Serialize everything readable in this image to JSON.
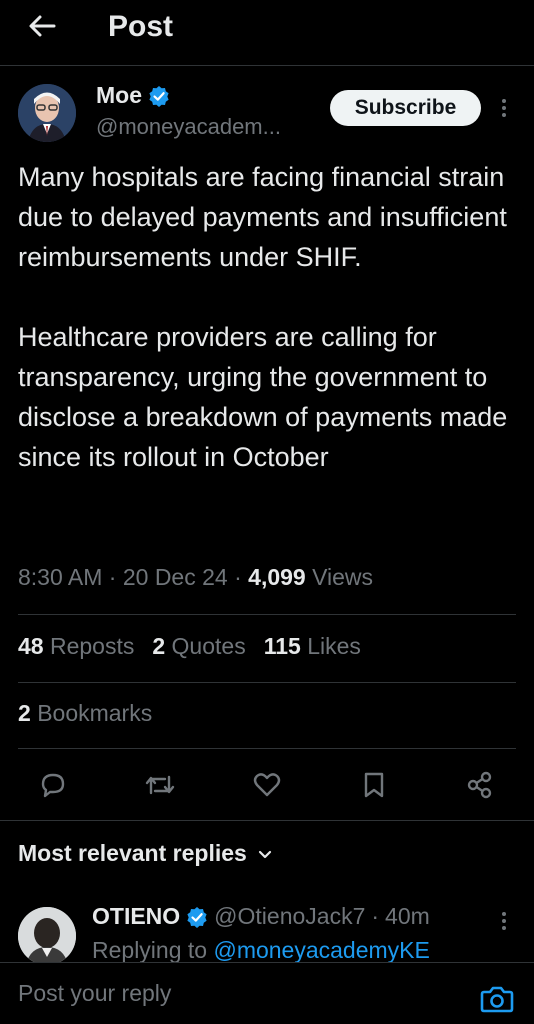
{
  "header": {
    "title": "Post",
    "back_icon": "arrow-left-icon"
  },
  "post": {
    "author": {
      "name": "Moe",
      "handle": "@moneyacadem...",
      "verified": true,
      "subscribe_label": "Subscribe"
    },
    "paragraphs": [
      "Many hospitals are facing financial strain due to delayed payments and insufficient reimbursements under SHIF.",
      "Healthcare providers are calling for transparency, urging the government to disclose a breakdown of payments made since its rollout in October"
    ],
    "time": "8:30 AM",
    "date": "20 Dec 24",
    "views_count": "4,099",
    "views_label": "Views",
    "separator": "·",
    "stats": {
      "reposts_count": "48",
      "reposts_label": "Reposts",
      "quotes_count": "2",
      "quotes_label": "Quotes",
      "likes_count": "115",
      "likes_label": "Likes",
      "bookmarks_count": "2",
      "bookmarks_label": "Bookmarks"
    },
    "actions": [
      "reply-icon",
      "repost-icon",
      "like-icon",
      "bookmark-icon",
      "share-icon"
    ]
  },
  "replies": {
    "filter_label": "Most relevant replies",
    "items": [
      {
        "name": "OTIENO",
        "handle": "@OtienoJack7",
        "separator": "·",
        "age": "40m",
        "replying_to_label": "Replying to",
        "replying_to_handle": "@moneyacademyKE",
        "verified": true
      }
    ]
  },
  "composer": {
    "placeholder": "Post your reply",
    "camera_icon": "camera-icon"
  },
  "colors": {
    "background": "#000000",
    "text": "#e7e9ea",
    "muted": "#71767b",
    "accent": "#1d9bf0",
    "divider": "#2f3336"
  }
}
